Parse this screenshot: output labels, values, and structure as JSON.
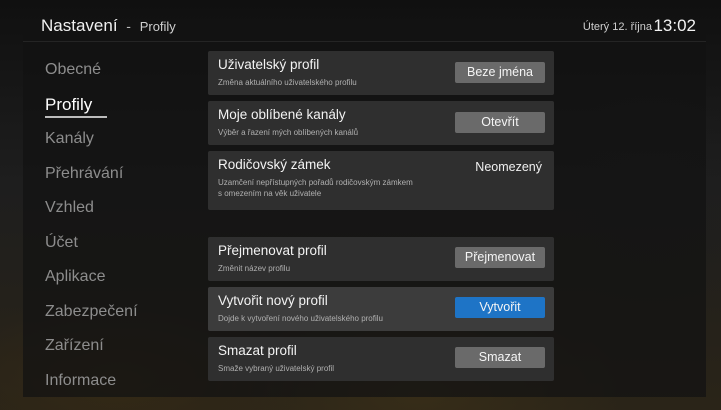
{
  "header": {
    "title": "Nastavení",
    "separator": "-",
    "subtitle": "Profily",
    "date": "Úterý 12. října",
    "time": "13:02"
  },
  "nav": {
    "items": [
      {
        "label": "Obecné",
        "active": false
      },
      {
        "label": "Profily",
        "active": true
      },
      {
        "label": "Kanály",
        "active": false
      },
      {
        "label": "Přehrávání",
        "active": false
      },
      {
        "label": "Vzhled",
        "active": false
      },
      {
        "label": "Účet",
        "active": false
      },
      {
        "label": "Aplikace",
        "active": false
      },
      {
        "label": "Zabezpečení",
        "active": false
      },
      {
        "label": "Zařízení",
        "active": false
      },
      {
        "label": "Informace",
        "active": false
      }
    ]
  },
  "settings": {
    "user_profile": {
      "title": "Uživatelský profil",
      "description": "Změna aktuálního uživatelského profilu",
      "button": "Beze jména"
    },
    "favorite_channels": {
      "title": "Moje oblíbené kanály",
      "description": "Výběr a řazení mých oblíbených kanálů",
      "button": "Otevřít"
    },
    "parental_lock": {
      "title": "Rodičovský zámek",
      "description": "Uzamčení nepřístupných pořadů rodičovským zámkem s omezením na věk uživatele",
      "value": "Neomezený"
    },
    "rename_profile": {
      "title": "Přejmenovat profil",
      "description": "Změnit název profilu",
      "button": "Přejmenovat"
    },
    "create_profile": {
      "title": "Vytvořit nový profil",
      "description": "Dojde k vytvoření nového uživatelského profilu",
      "button": "Vytvořit"
    },
    "delete_profile": {
      "title": "Smazat profil",
      "description": "Smaže vybraný uživatelský profil",
      "button": "Smazat"
    }
  },
  "colors": {
    "accent": "#1e74c6",
    "button": "#6a6a6a",
    "panel": "#2f2f2f",
    "panel_focused": "#3c3c3c"
  }
}
